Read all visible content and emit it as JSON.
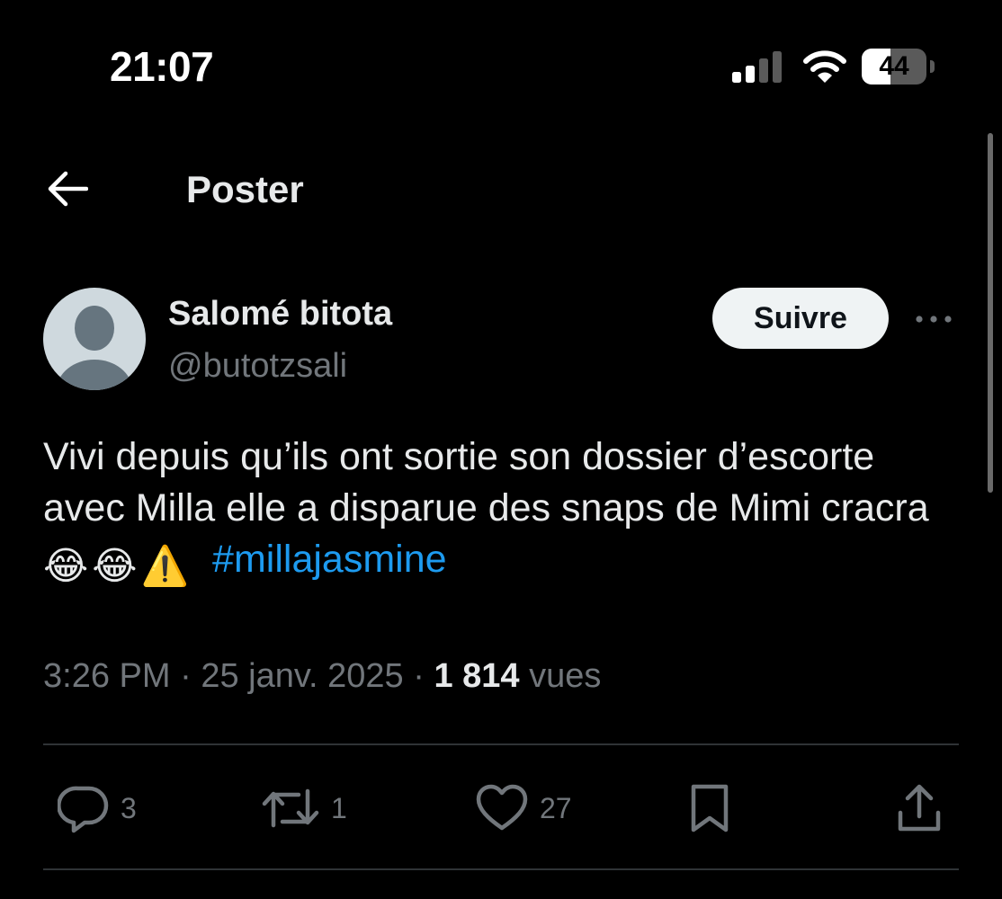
{
  "status_bar": {
    "time": "21:07",
    "battery_level": "44",
    "battery_fraction": 0.44
  },
  "header": {
    "title": "Poster"
  },
  "author": {
    "display_name": "Salomé bitota",
    "handle": "@butotzsali",
    "follow_label": "Suivre"
  },
  "tweet": {
    "text": "Vivi depuis qu’ils ont sortie son dossier d’escorte avec Milla elle a disparue des snaps de Mimi cracra",
    "emojis": [
      "😂",
      "😂",
      "⚠️"
    ],
    "hashtag": "#millajasmine"
  },
  "meta": {
    "time": "3:26 PM",
    "date": "25 janv. 2025",
    "separator": "·",
    "views_count": "1 814",
    "views_label": "vues"
  },
  "actions": {
    "replies": "3",
    "reposts": "1",
    "likes": "27"
  },
  "icons": {
    "back": "arrow-left-icon",
    "more": "more-horizontal-icon",
    "reply": "reply-icon",
    "repost": "repost-icon",
    "like": "heart-icon",
    "bookmark": "bookmark-icon",
    "share": "share-icon"
  },
  "colors": {
    "background": "#000000",
    "text": "#e7e9ea",
    "secondary_text": "#71767b",
    "hashtag": "#1d9bf0",
    "follow_button_bg": "#eff3f4",
    "divider": "#2f3336"
  }
}
